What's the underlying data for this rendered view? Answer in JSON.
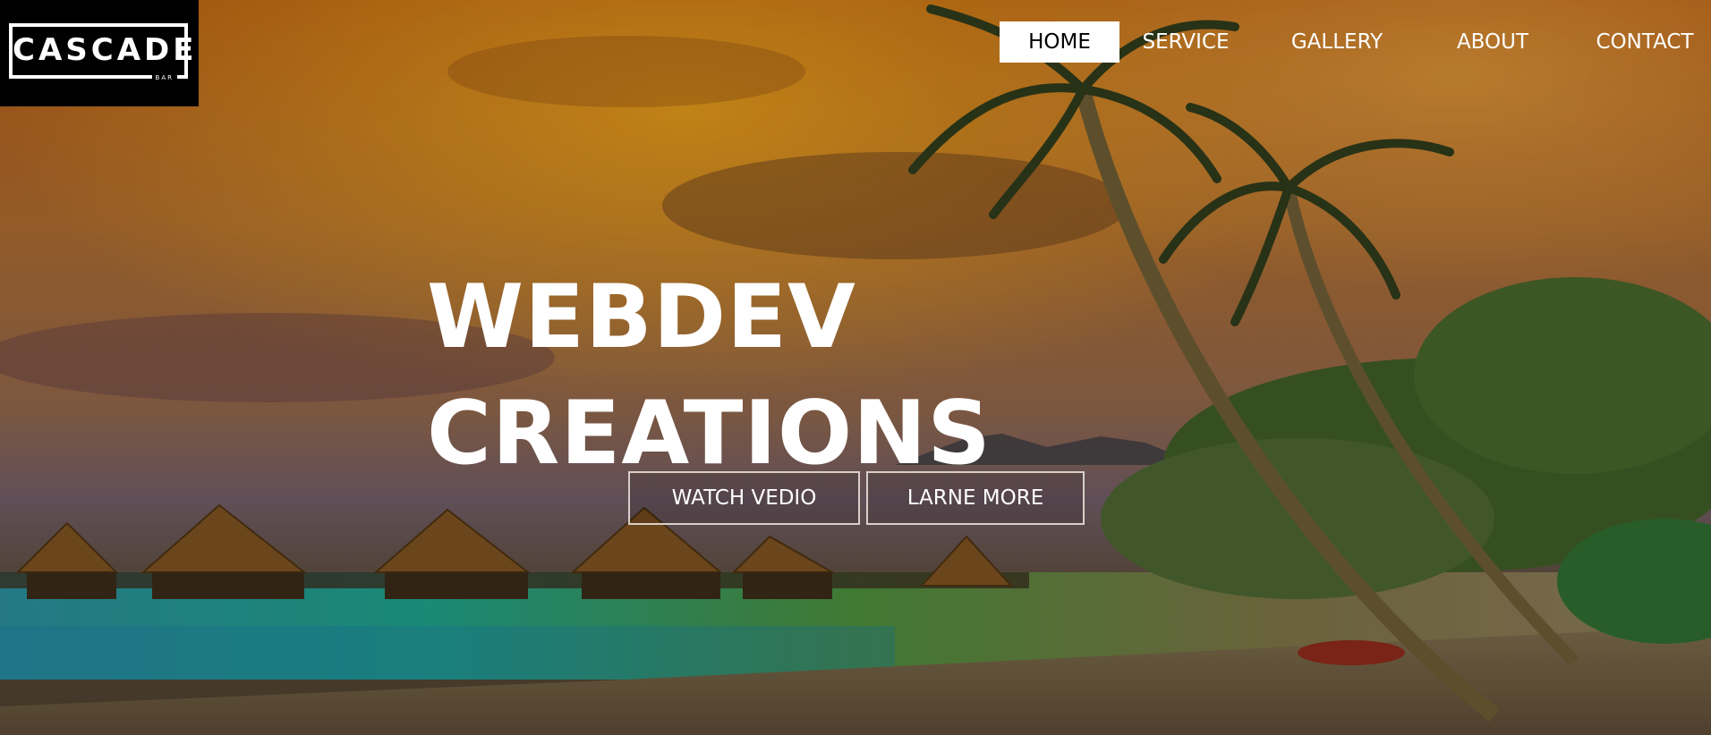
{
  "brand": {
    "name": "CASCADE",
    "subtitle": "BAR"
  },
  "nav": {
    "items": [
      {
        "label": "HOME",
        "active": true
      },
      {
        "label": "SERVICE",
        "active": false
      },
      {
        "label": "GALLERY",
        "active": false
      },
      {
        "label": "ABOUT",
        "active": false
      },
      {
        "label": "CONTACT",
        "active": false
      }
    ]
  },
  "hero": {
    "title_line1": "WEBDEV",
    "title_line2": "CREATIONS",
    "buttons": {
      "watch": "WATCH VEDIO",
      "learn": "LARNE MORE"
    }
  },
  "colors": {
    "sky_top": "#b8621a",
    "sky_mid": "#a86b3c",
    "water": "#2a9a8a",
    "sand": "#8a7a5a",
    "foliage": "#4a6a2a"
  }
}
